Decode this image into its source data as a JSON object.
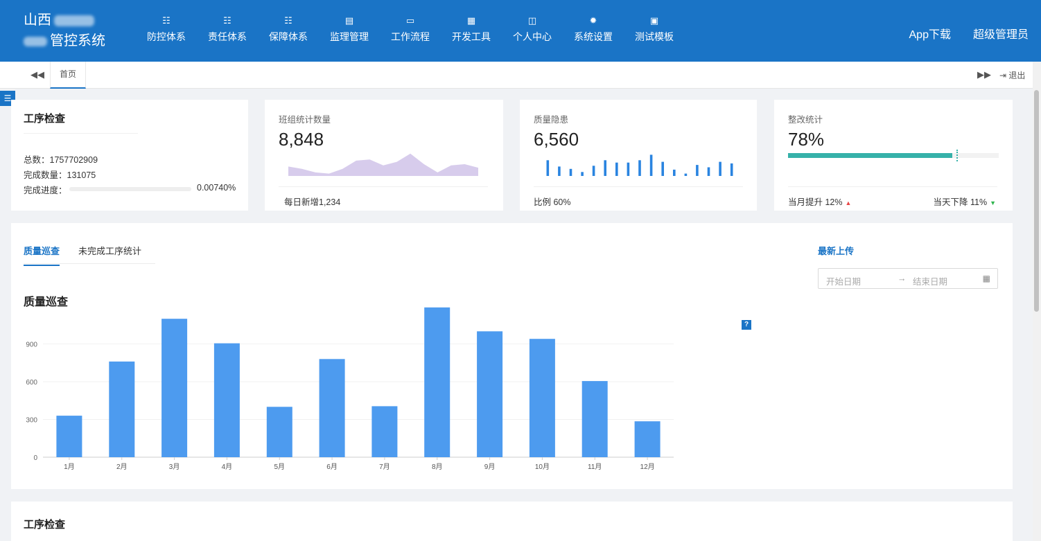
{
  "header": {
    "brand_line1": "山西",
    "brand_line2": "管控系统",
    "nav": [
      {
        "icon": "list-icon",
        "glyph": "☷",
        "label": "防控体系"
      },
      {
        "icon": "list-icon",
        "glyph": "☷",
        "label": "责任体系"
      },
      {
        "icon": "list-icon",
        "glyph": "☷",
        "label": "保障体系"
      },
      {
        "icon": "table-icon",
        "glyph": "▤",
        "label": "监理管理"
      },
      {
        "icon": "monitor-icon",
        "glyph": "▭",
        "label": "工作流程"
      },
      {
        "icon": "grid-icon",
        "glyph": "▦",
        "label": "开发工具"
      },
      {
        "icon": "columns-icon",
        "glyph": "◫",
        "label": "个人中心"
      },
      {
        "icon": "gear-icon",
        "glyph": "✹",
        "label": "系统设置"
      },
      {
        "icon": "save-icon",
        "glyph": "▣",
        "label": "测试模板"
      }
    ],
    "app_download": "App下载",
    "user": "超级管理员"
  },
  "tabs": {
    "prev": "◀◀",
    "home": "首页",
    "next": "▶▶",
    "exit": "⇥ 退出"
  },
  "cards": {
    "process": {
      "title": "工序检查",
      "total_label": "总数：",
      "total": "1757702909",
      "done_label": "完成数量：",
      "done": "131075",
      "progress_label": "完成进度：",
      "progress_text": "0.00740%",
      "progress_fraction": 7.46e-05
    },
    "team": {
      "title": "班组统计数量",
      "value": "8,848",
      "footer": "每日新增1,234"
    },
    "hazard": {
      "title": "质量隐患",
      "value": "6,560",
      "footer": "比例   60%"
    },
    "rectify": {
      "title": "整改统计",
      "value": "78%",
      "fraction": 0.78,
      "target_fraction": 0.8,
      "month_up": "当月提升   12%",
      "day_down": "当天下降   11%"
    }
  },
  "main": {
    "tab_active": "质量巡查",
    "tab_other": "未完成工序统计",
    "latest_upload": "最新上传",
    "date_start_placeholder": "开始日期",
    "date_arrow": "→",
    "date_end_placeholder": "结束日期",
    "chart_title": "质量巡查",
    "help": "?"
  },
  "chart_data": {
    "type": "bar",
    "categories": [
      "1月",
      "2月",
      "3月",
      "4月",
      "5月",
      "6月",
      "7月",
      "8月",
      "9月",
      "10月",
      "11月",
      "12月"
    ],
    "values": [
      330,
      760,
      1100,
      905,
      400,
      780,
      405,
      1190,
      1000,
      940,
      605,
      285
    ],
    "yticks": [
      0,
      300,
      600,
      900
    ],
    "ylim": [
      0,
      1200
    ],
    "color": "#4d9bef",
    "grid": true
  },
  "sparkline_area": {
    "values": [
      8,
      6,
      3,
      2,
      6,
      13,
      14,
      9,
      12,
      19,
      10,
      3,
      9,
      10,
      7
    ]
  },
  "sparkline_bars": {
    "values": [
      20,
      12,
      9,
      5,
      13,
      20,
      17,
      17,
      20,
      27,
      18,
      8,
      3,
      14,
      11,
      18,
      16
    ]
  },
  "bottom": {
    "title": "工序检查"
  },
  "colors": {
    "primary": "#1a74c6",
    "teal": "#36b1a9",
    "area_fill": "#d7ccec",
    "spark_bar": "#2a84e0"
  }
}
